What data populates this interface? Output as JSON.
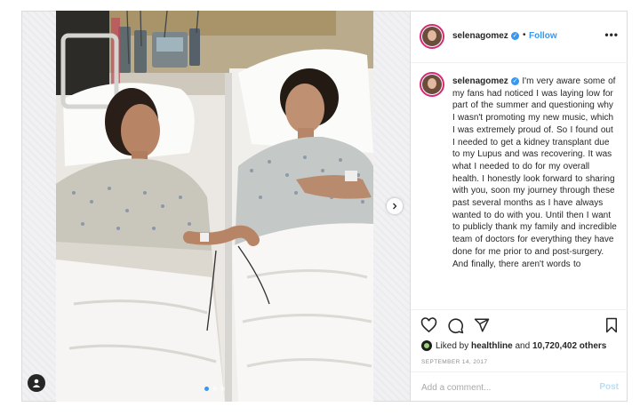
{
  "post": {
    "username": "selenagomez",
    "verified_mark": "✓",
    "separator": "•",
    "follow_label": "Follow",
    "more_label": "•••",
    "caption_text": "I'm very aware some of my fans had noticed I was laying low for part of the summer and questioning why I wasn't promoting my new music, which I was extremely proud of. So I found out I needed to get a kidney transplant due to my Lupus and was recovering. It was what I needed to do for my overall health. I honestly look forward to sharing with you, soon my journey through these past several months as I have always wanted to do with you. Until then I want to publicly thank my family and incredible team of doctors for everything they have done for me prior to and post-surgery. And finally, there aren't words to",
    "likes": {
      "prefix": "Liked by",
      "liker": "healthline",
      "conjunction": "and",
      "others": "10,720,402 others"
    },
    "date": "SEPTEMBER 14, 2017",
    "comment": {
      "placeholder": "Add a comment...",
      "value": "",
      "post_label": "Post"
    }
  },
  "carousel": {
    "slide_count": 3,
    "active_slide": 1
  },
  "icons": {
    "like": "heart-icon",
    "comment": "comment-icon",
    "share": "share-icon",
    "save": "bookmark-icon",
    "next": "chevron-right-icon",
    "tag": "user-tag-icon"
  },
  "colors": {
    "accent": "#3897f0",
    "text": "#262626",
    "muted": "#8e8e8e",
    "border": "#dbdbdb",
    "post_disabled": "#b2dffc",
    "avatar_ring": "#d62976"
  }
}
